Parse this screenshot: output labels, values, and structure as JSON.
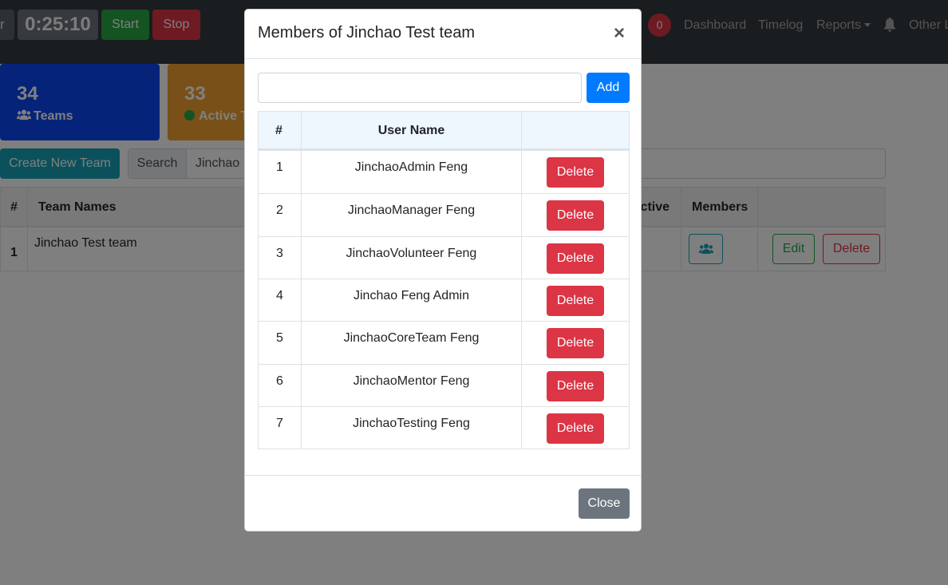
{
  "navbar": {
    "cut_label": "r",
    "timer": "0:25:10",
    "start_label": "Start",
    "stop_label": "Stop",
    "notification_count": "0",
    "links": {
      "dashboard": "Dashboard",
      "timelog": "Timelog",
      "reports": "Reports",
      "other": "Other L"
    }
  },
  "stats": {
    "teams_count": "34",
    "teams_label": "Teams",
    "active_count": "33",
    "active_label": "Active T"
  },
  "toolbar": {
    "create_label": "Create New Team",
    "search_label": "Search",
    "search_value": "Jinchao"
  },
  "teams_table": {
    "headers": {
      "index": "#",
      "name": "Team Names",
      "active": "Active",
      "members": "Members"
    },
    "rows": [
      {
        "index": "1",
        "name": "Jinchao Test team",
        "edit": "Edit",
        "delete": "Delete"
      }
    ]
  },
  "modal": {
    "title": "Members of Jinchao Test team",
    "close_x": "×",
    "add_input_value": "",
    "add_label": "Add",
    "headers": {
      "index": "#",
      "user_name": "User Name"
    },
    "members": [
      {
        "index": "1",
        "name": "JinchaoAdmin Feng",
        "delete": "Delete"
      },
      {
        "index": "2",
        "name": "JinchaoManager Feng",
        "delete": "Delete"
      },
      {
        "index": "3",
        "name": "JinchaoVolunteer Feng",
        "delete": "Delete"
      },
      {
        "index": "4",
        "name": "Jinchao Feng Admin",
        "delete": "Delete"
      },
      {
        "index": "5",
        "name": "JinchaoCoreTeam Feng",
        "delete": "Delete"
      },
      {
        "index": "6",
        "name": "JinchaoMentor Feng",
        "delete": "Delete"
      },
      {
        "index": "7",
        "name": "JinchaoTesting Feng",
        "delete": "Delete"
      }
    ],
    "close_label": "Close"
  },
  "colors": {
    "navbar": "#343a40",
    "primary": "#007bff",
    "danger": "#dc3545",
    "success": "#28a745",
    "info": "#17a2b8",
    "secondary": "#6c757d"
  }
}
